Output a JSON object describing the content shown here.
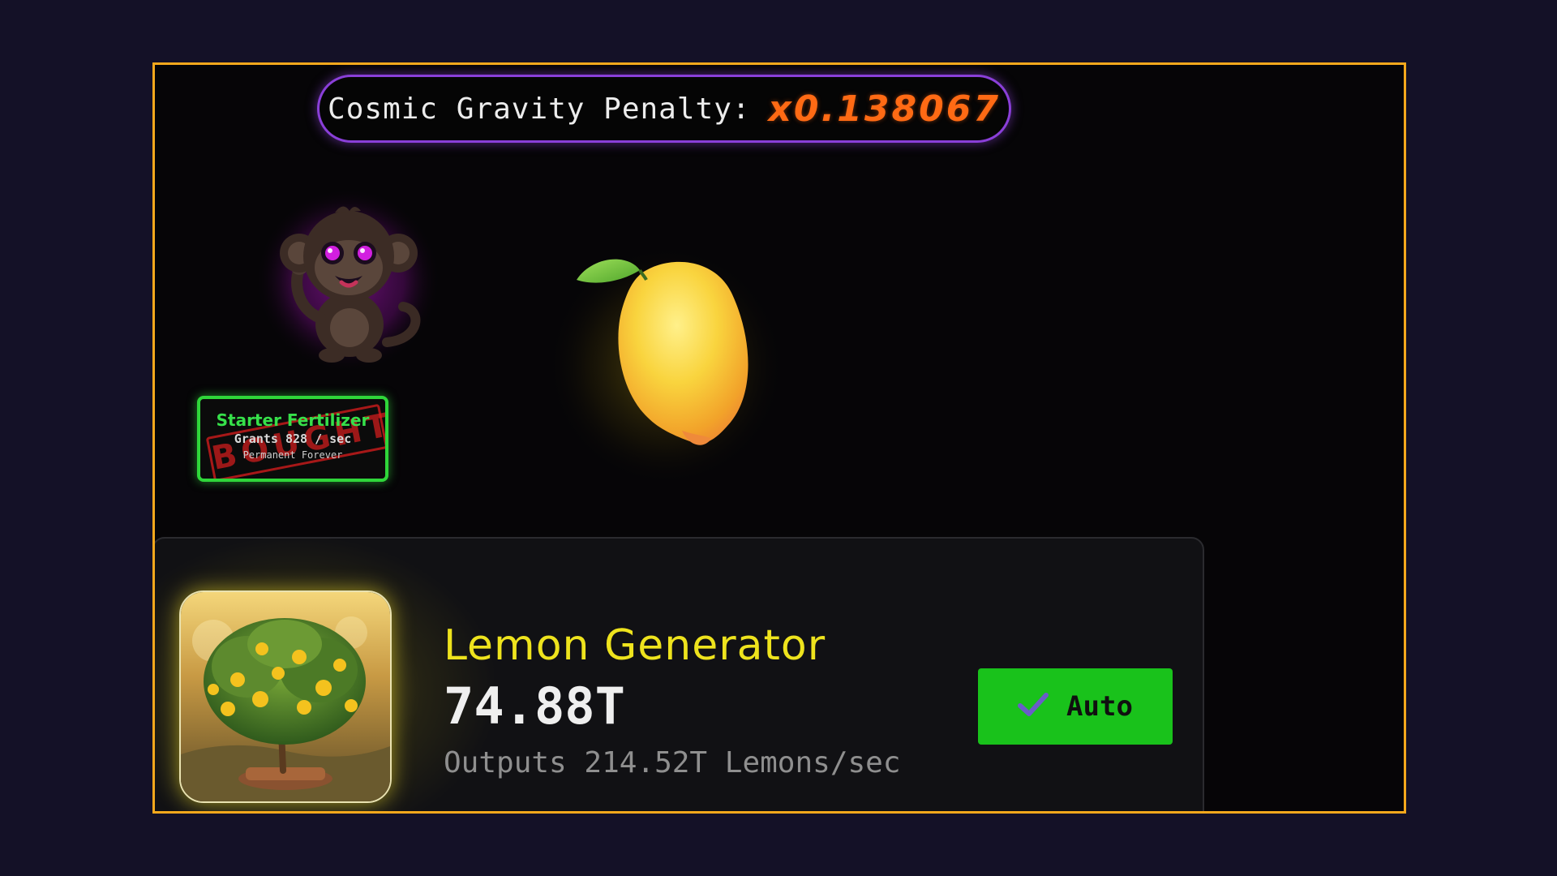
{
  "colors": {
    "frame_border": "#f5a81c",
    "penalty_value": "#ff6a14",
    "penalty_border": "#8a3fd8",
    "fertilizer_green": "#36e04a",
    "generator_title": "#eee31d",
    "auto_button": "#19c21b"
  },
  "penalty": {
    "label": "Cosmic Gravity Penalty:",
    "value": "x0.138067"
  },
  "pet": {
    "icon": "monkey-icon"
  },
  "fertilizer": {
    "title": "Starter Fertilizer",
    "grants": "Grants 828 / sec",
    "duration": "Permanent Forever",
    "stamp": "BOUGHT"
  },
  "clicker": {
    "icon": "lemon-icon"
  },
  "generator": {
    "icon": "lemon-tree-icon",
    "name": "Lemon Generator",
    "amount": "74.88T",
    "output": "Outputs 214.52T Lemons/sec",
    "auto_label": "Auto",
    "auto_icon": "check-icon"
  }
}
